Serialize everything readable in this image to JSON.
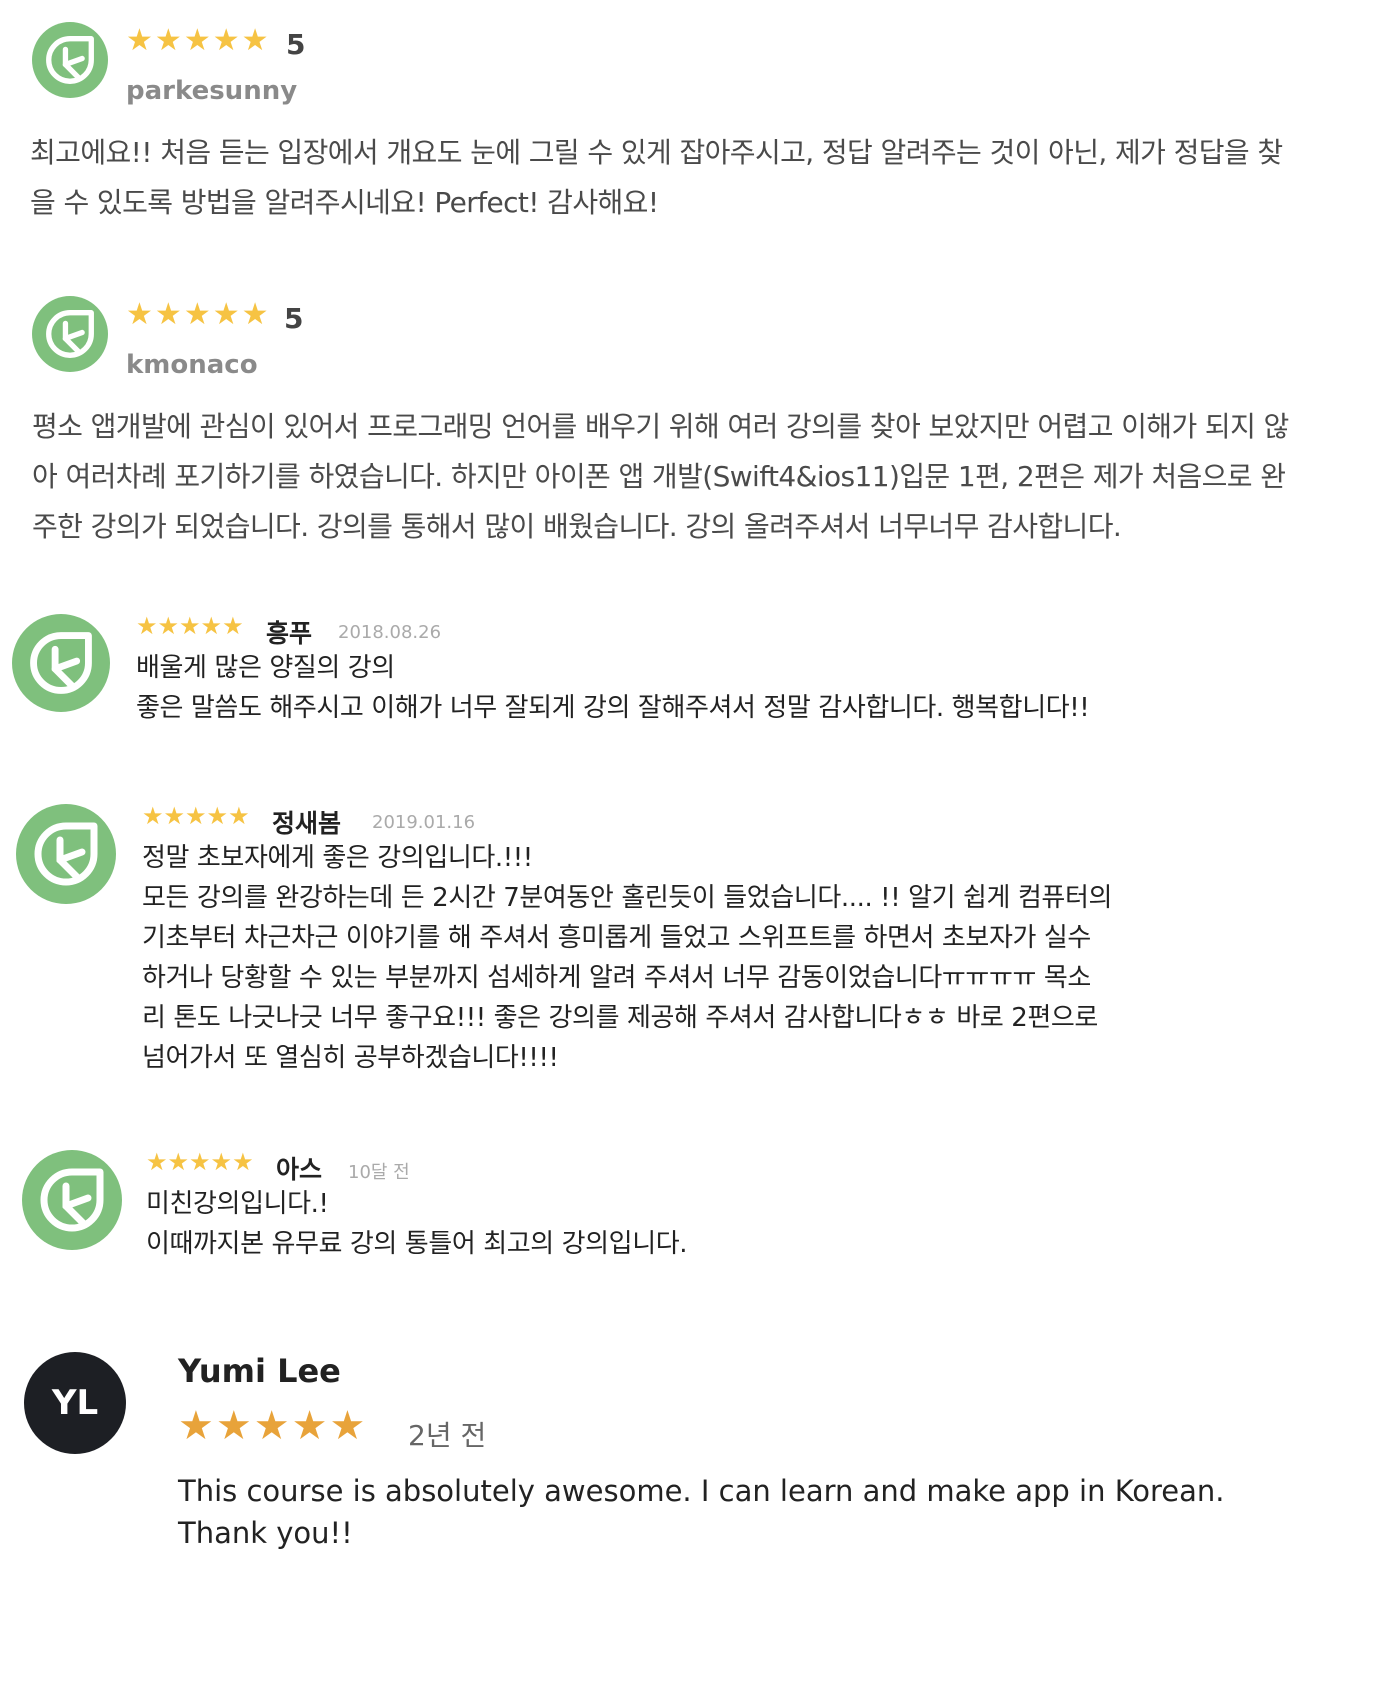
{
  "colors": {
    "leaf_green": "#7fc07d",
    "star_yellow": "#f6c343",
    "star_orange": "#e8a33a",
    "dark_avatar": "#1d1f24"
  },
  "reviews_a": [
    {
      "avatar_icon": "leaf-icon",
      "stars": 5,
      "rating": "5",
      "user": "parkesunny",
      "text": "최고에요!! 처음 듣는 입장에서 개요도 눈에 그릴 수 있게 잡아주시고, 정답 알려주는 것이 아닌, 제가 정답을 찾을 수 있도록 방법을 알려주시네요! Perfect! 감사해요!"
    },
    {
      "avatar_icon": "leaf-icon",
      "stars": 5,
      "rating": "5",
      "user": "kmonaco",
      "text": "평소 앱개발에 관심이 있어서 프로그래밍 언어를 배우기 위해 여러 강의를 찾아 보았지만 어렵고 이해가 되지 않아 여러차례 포기하기를 하였습니다. 하지만 아이폰 앱 개발(Swift4&ios11)입문 1편, 2편은 제가 처음으로 완주한 강의가 되었습니다. 강의를 통해서 많이 배웠습니다. 강의 올려주셔서 너무너무 감사합니다."
    }
  ],
  "reviews_b": [
    {
      "avatar_icon": "leaf-icon",
      "stars": 5,
      "user": "흥푸",
      "date": "2018.08.26",
      "lines": [
        "배울게 많은 양질의 강의",
        "좋은 말씀도 해주시고 이해가 너무 잘되게 강의 잘해주셔서 정말 감사합니다. 행복합니다!!"
      ]
    },
    {
      "avatar_icon": "leaf-icon",
      "stars": 5,
      "user": "정새봄",
      "date": "2019.01.16",
      "lines": [
        "정말 초보자에게 좋은 강의입니다.!!!",
        "모든 강의를 완강하는데 든 2시간 7분여동안 홀린듯이 들었습니다.... !! 알기 쉽게 컴퓨터의",
        "기초부터 차근차근 이야기를 해 주셔서 흥미롭게 들었고 스위프트를 하면서 초보자가 실수",
        "하거나 당황할 수 있는 부분까지 섬세하게 알려 주셔서 너무 감동이었습니다ㅠㅠㅠㅠ 목소",
        "리 톤도 나긋나긋 너무 좋구요!!! 좋은 강의를 제공해 주셔서 감사합니다ㅎㅎ 바로 2편으로",
        "넘어가서 또 열심히 공부하겠습니다!!!!"
      ]
    },
    {
      "avatar_icon": "leaf-icon",
      "stars": 5,
      "user": "아스",
      "date": "10달 전",
      "lines": [
        "미친강의입니다.!",
        "이때까지본 유무료 강의 통틀어 최고의 강의입니다."
      ]
    }
  ],
  "review_c": {
    "initials": "YL",
    "user": "Yumi Lee",
    "stars": 5,
    "date": "2년 전",
    "text": "This course is absolutely awesome. I can learn and make app in Korean. Thank you!!"
  }
}
